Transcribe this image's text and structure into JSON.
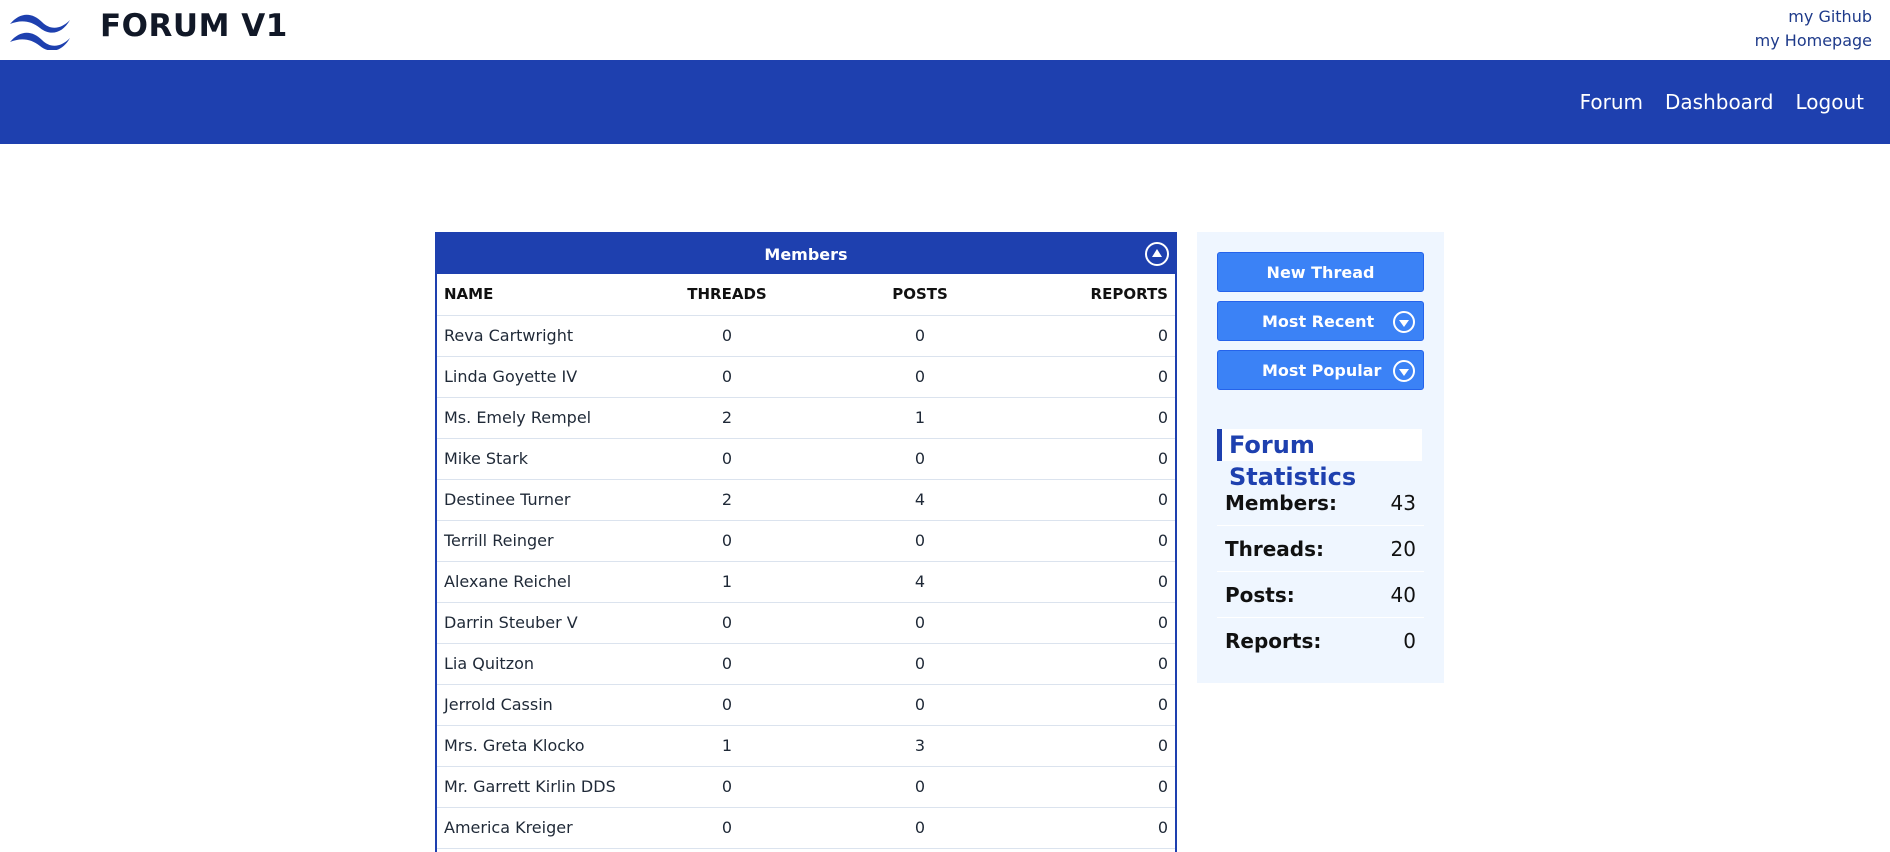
{
  "header": {
    "brand": "FORUM V1",
    "links": [
      "my Github",
      "my Homepage"
    ]
  },
  "nav": {
    "items": [
      "Forum",
      "Dashboard",
      "Logout"
    ]
  },
  "members": {
    "title": "Members",
    "columns": [
      "NAME",
      "THREADS",
      "POSTS",
      "REPORTS"
    ],
    "rows": [
      {
        "name": "Reva Cartwright",
        "threads": "0",
        "posts": "0",
        "reports": "0"
      },
      {
        "name": "Linda Goyette IV",
        "threads": "0",
        "posts": "0",
        "reports": "0"
      },
      {
        "name": "Ms. Emely Rempel",
        "threads": "2",
        "posts": "1",
        "reports": "0"
      },
      {
        "name": "Mike Stark",
        "threads": "0",
        "posts": "0",
        "reports": "0"
      },
      {
        "name": "Destinee Turner",
        "threads": "2",
        "posts": "4",
        "reports": "0"
      },
      {
        "name": "Terrill Reinger",
        "threads": "0",
        "posts": "0",
        "reports": "0"
      },
      {
        "name": "Alexane Reichel",
        "threads": "1",
        "posts": "4",
        "reports": "0"
      },
      {
        "name": "Darrin Steuber V",
        "threads": "0",
        "posts": "0",
        "reports": "0"
      },
      {
        "name": "Lia Quitzon",
        "threads": "0",
        "posts": "0",
        "reports": "0"
      },
      {
        "name": "Jerrold Cassin",
        "threads": "0",
        "posts": "0",
        "reports": "0"
      },
      {
        "name": "Mrs. Greta Klocko",
        "threads": "1",
        "posts": "3",
        "reports": "0"
      },
      {
        "name": "Mr. Garrett Kirlin DDS",
        "threads": "0",
        "posts": "0",
        "reports": "0"
      },
      {
        "name": "America Kreiger",
        "threads": "0",
        "posts": "0",
        "reports": "0"
      }
    ]
  },
  "sidebar": {
    "new_thread": "New Thread",
    "most_recent": "Most Recent",
    "most_popular": "Most Popular",
    "stats_title": "Forum Statistics",
    "stats": [
      {
        "label": "Members:",
        "value": "43"
      },
      {
        "label": "Threads:",
        "value": "20"
      },
      {
        "label": "Posts:",
        "value": "40"
      },
      {
        "label": "Reports:",
        "value": "0"
      }
    ]
  },
  "colors": {
    "primary": "#1e40af",
    "button": "#3b82f6",
    "sidebar_bg": "#eff6ff"
  },
  "icons": [
    "logo-wave-icon",
    "collapse-up-icon",
    "chevron-down-icon"
  ]
}
